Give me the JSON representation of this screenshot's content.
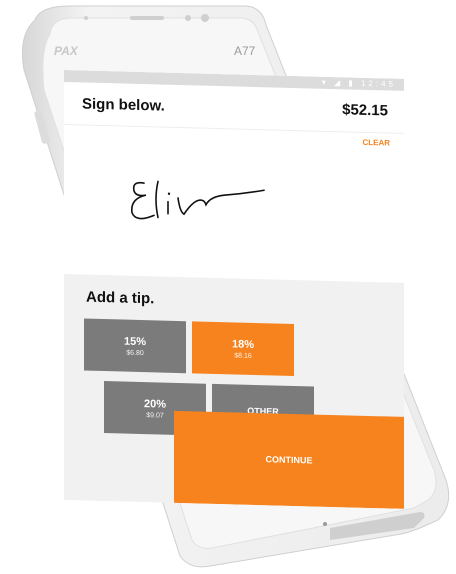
{
  "device": {
    "brand": "PAX",
    "model": "A77"
  },
  "status_bar": {
    "icons": "▾ ◢ ▮ 12:45"
  },
  "header": {
    "title": "Sign below.",
    "amount": "$52.15"
  },
  "signature": {
    "clear_label": "CLEAR"
  },
  "tip": {
    "title": "Add a tip.",
    "options": [
      {
        "percent": "15%",
        "amount": "$6.80"
      },
      {
        "percent": "18%",
        "amount": "$8.16"
      },
      {
        "percent": "20%",
        "amount": "$9.07"
      },
      {
        "percent": "OTHER",
        "amount": ""
      }
    ],
    "selected": "18%"
  },
  "continue_label": "CONTINUE",
  "colors": {
    "accent": "#f7831e",
    "button_gray": "#7b7b7b",
    "panel": "#f1f1f1"
  }
}
